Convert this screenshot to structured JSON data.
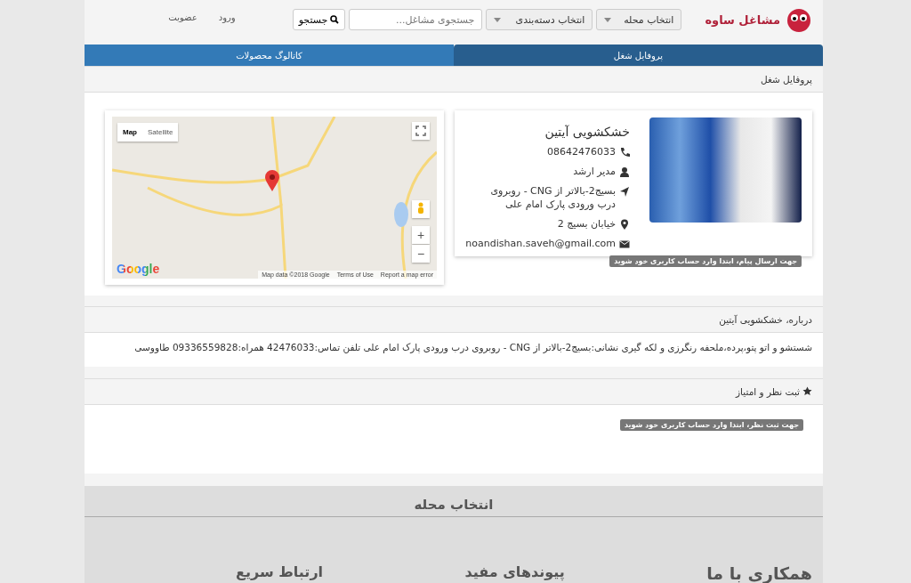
{
  "header": {
    "logo": "مشاغل ساوه",
    "district_select": "انتخاب محله",
    "category_select": "انتخاب دسته‌بندی",
    "search": {
      "placeholder": "جستجوی مشاغل..."
    },
    "search_button": "جستجو",
    "links": [
      "ورود",
      "عضویت"
    ]
  },
  "tabs": [
    {
      "label": "پروفایل شغل",
      "selected": true
    },
    {
      "label": "کاتالوگ محصولات",
      "selected": false
    }
  ],
  "profile": {
    "heading": "پروفایل شغل",
    "name": "خشکشویی آیتین",
    "details": [
      {
        "kind": "phone",
        "text": "08642476033"
      },
      {
        "kind": "person",
        "text": "مدیر ارشد"
      },
      {
        "kind": "address",
        "text": "بسیج2-بالاتر از CNG - روبروی درب ورودی پارک امام علی"
      },
      {
        "kind": "location",
        "text": "خیابان بسیج 2"
      },
      {
        "kind": "email",
        "text": "noandishan.saveh@gmail.com"
      }
    ],
    "notice": "جهت ارسال پیام، ابتدا وارد حساب کاربری خود شوید"
  },
  "map": {
    "map_toggle": {
      "label": "Map",
      "selected": true
    },
    "satellite_toggle": {
      "label": "Satellite",
      "selected": false
    },
    "logo": "Google",
    "attribution": "Map data ©2018 Google",
    "terms_link": "Terms of Use",
    "report_link": "Report a map error",
    "zoom_in": "+",
    "zoom_out": "−"
  },
  "about": {
    "heading": "درباره، خشکشویی آیتین",
    "text": "شستشو و اتو پتو،پرده،ملحفه رنگرزی و لکه گیری نشانی:بسیج2-بالاتر از CNG - روبروی درب ورودی پارک امام علی تلفن تماس:42476033 همراه:09336559828 طاووسی"
  },
  "rating": {
    "heading": "ثبت نظر و امتیاز",
    "notice": "جهت ثبت نظر، ابتدا وارد حساب کاربری خود شوید"
  },
  "footer": {
    "heading": "انتخاب محله",
    "columns": [
      "همکاری با ما",
      "پیوندهای مفید",
      "ارتباط سریع"
    ]
  }
}
